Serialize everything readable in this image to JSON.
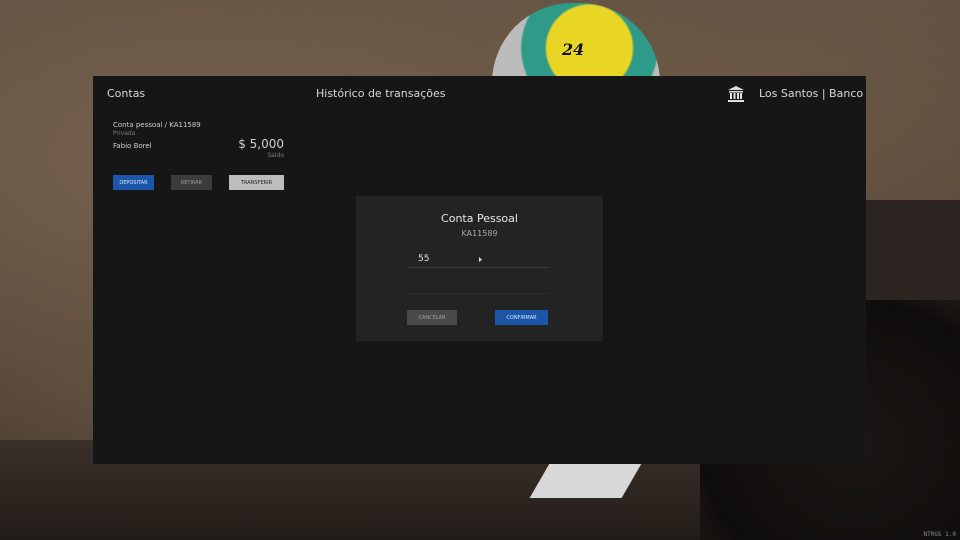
{
  "header": {
    "accounts_label": "Contas",
    "history_label": "Histórico de transações",
    "bank_name": "Los Santos | Banco",
    "bank_icon": "bank-building-icon"
  },
  "account": {
    "label": "Conta pessoal / KA11589",
    "type": "Privada",
    "owner": "Fabio Borel",
    "balance": "$ 5,000",
    "balance_label": "Saldo"
  },
  "actions": {
    "deposit": "DEPOSITAR",
    "withdraw": "RETIRAR",
    "transfer": "TRANSFERIR"
  },
  "modal": {
    "title": "Conta Pessoal",
    "subtitle": "KA11589",
    "amount_value": "55",
    "second_value": "",
    "cancel": "CANCELAR",
    "confirm": "CONFIRMAR"
  },
  "scene": {
    "hat_number": "24",
    "watermark": "NTRGS 1.0"
  },
  "colors": {
    "accent_blue": "#1c56a8",
    "panel_bg": "#161616",
    "modal_bg": "#232323"
  }
}
